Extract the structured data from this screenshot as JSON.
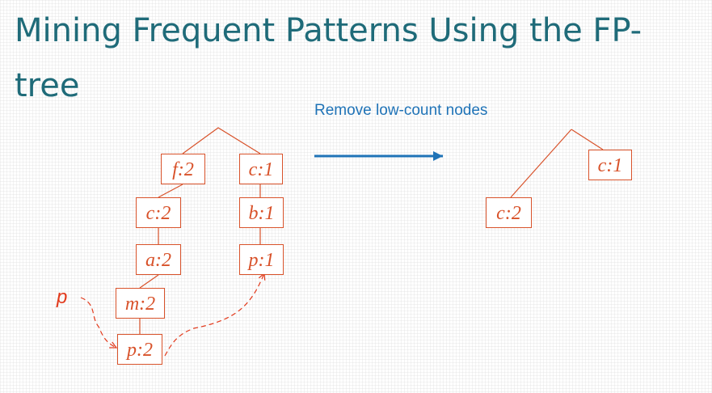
{
  "slide": {
    "title_line_1": "Mining Frequent Patterns Using the FP-",
    "title_line_2": "tree"
  },
  "left_tree": {
    "nodes": {
      "f2": "f:2",
      "c2": "c:2",
      "a2": "a:2",
      "m2": "m:2",
      "p2": "p:2",
      "c1": "c:1",
      "b1": "b:1",
      "p1": "p:1"
    },
    "pointer_label": "p"
  },
  "transform": {
    "caption": "Remove low-count nodes"
  },
  "right_tree": {
    "nodes": {
      "c2": "c:2",
      "c1": "c:1"
    }
  },
  "colors": {
    "title": "#1f6b79",
    "tree": "#d8522a",
    "arrow": "#1f73b7",
    "pointer": "#e23a1c"
  }
}
